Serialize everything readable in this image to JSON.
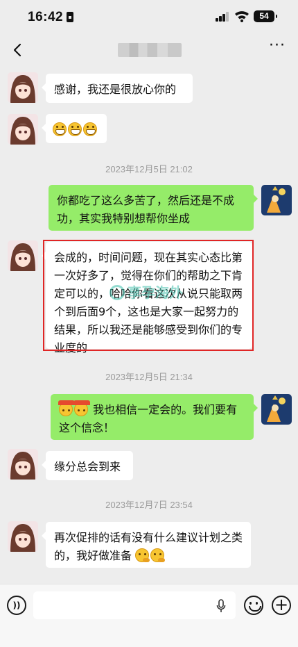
{
  "status_bar": {
    "time": "16:42",
    "battery": "54"
  },
  "header": {
    "more_label": "···"
  },
  "messages": [
    {
      "side": "in",
      "text": "感谢，我还是很放心你的"
    },
    {
      "side": "in",
      "emojis": [
        "grin",
        "grin",
        "grin"
      ]
    },
    {
      "side": "out",
      "text": "你都吃了这么多苦了，然后还是不成功，其实我特别想帮你坐成"
    },
    {
      "side": "in",
      "text": "会成的，时间问题，现在其实心态比第一次好多了，觉得在你们的帮助之下肯定可以的，哈哈你看这次从说只能取两个到后面9个，这也是大家一起努力的结果，所以我还是能够感受到你们的专业度的"
    },
    {
      "side": "out",
      "emojis": [
        "cheer",
        "cheer"
      ],
      "text": "我也相信一定会的。我们要有这个信念！"
    },
    {
      "side": "in",
      "text": "缘分总会到来"
    },
    {
      "side": "in",
      "text": "再次促排的话有没有什么建议计划之类的，我好做准备",
      "emojis": [
        "think",
        "think"
      ]
    }
  ],
  "timestamps": [
    "2023年12月5日 21:02",
    "2023年12月5日 21:34",
    "2023年12月7日 23:54"
  ],
  "watermark": "享孕海外",
  "input_bar": {
    "voice_label": "))",
    "plus_label": "+"
  },
  "colors": {
    "outgoing_bubble": "#95ec69",
    "incoming_bubble": "#ffffff",
    "background": "#ededed",
    "highlight": "#e02525"
  }
}
